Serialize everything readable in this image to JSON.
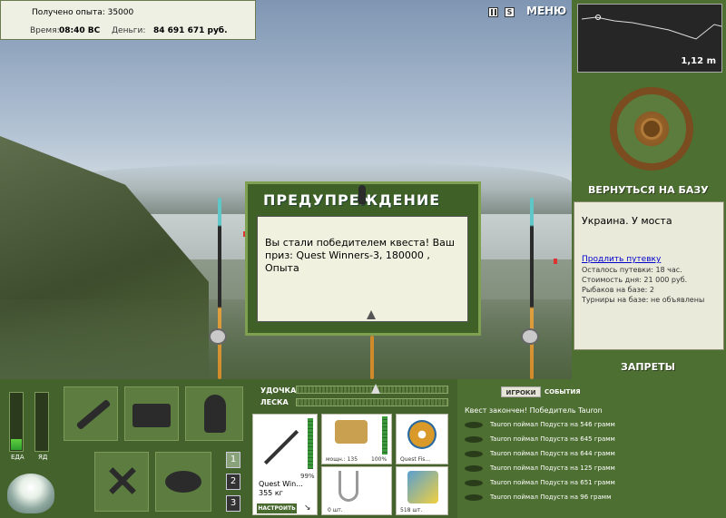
{
  "hud": {
    "exp_label": "Получено опыта: 35000",
    "time_label": "Время:",
    "time_value": "08:40 ВС",
    "money_label": "Деньги:",
    "money_value": "84 691 671 руб."
  },
  "top_buttons": {
    "menu_label": "МЕНЮ"
  },
  "depth": {
    "value": "1,12 m"
  },
  "base": {
    "return_label": "ВЕРНУТЬСЯ НА БАЗУ"
  },
  "location": {
    "title": "Украина. У моста",
    "extend_link": "Продлить путевку",
    "lines": [
      "Осталось путевки: 18 час.",
      "Стоимость дня: 21 000 руб.",
      "Рыбаков на базе: 2",
      "Турниры на базе: не объявлены"
    ]
  },
  "bans_label": "ЗАПРЕТЫ",
  "dialog": {
    "title": "ПРЕДУПРЕЖДЕНИЕ",
    "message": "Вы стали победителем квеста! Ваш приз: Quest Winners-3, 180000 , Опыта"
  },
  "sliders": {
    "rod_label": "УДОЧКА",
    "line_label": "ЛЕСКА"
  },
  "needs": {
    "food_label": "ЕДА",
    "poison_label": "ЯД",
    "food_level": 0.25,
    "poison_level": 0
  },
  "tackle": {
    "rod_name": "Quest Win...",
    "rod_weight": "355 кг",
    "rod_percent": "99%",
    "configure_label": "НАСТРОИТЬ",
    "reel_power": "мощн.: 135",
    "reel_percent": "100%",
    "line_name": "Quest Fis...",
    "hook_count": "0 шт.",
    "bait_count": "518 шт."
  },
  "page_numbers": [
    "1",
    "2",
    "3"
  ],
  "log": {
    "tab_players": "ИГРОКИ",
    "tab_events": "СОБЫТИЯ",
    "header": "Квест закончен! Победитель Tauron",
    "entries": [
      "Tauron поймал Подуста на 546 грамм",
      "Tauron поймал Подуста на 645 грамм",
      "Tauron поймал Подуста на 644 грамм",
      "Tauron поймал Подуста на 125 грамм",
      "Tauron поймал Подуста на 651 грамм",
      "Tauron поймал Подуста на 96 грамм"
    ]
  },
  "colors": {
    "panel": "#44632c",
    "accent": "#7fa050",
    "text_light": "#ffffff"
  }
}
